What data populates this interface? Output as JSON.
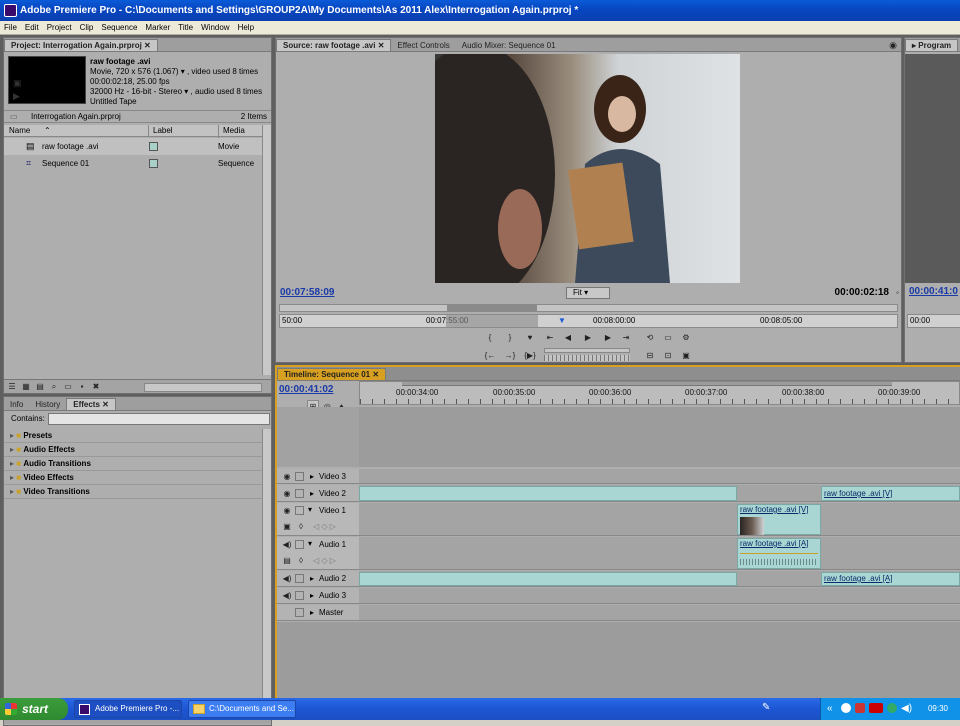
{
  "window": {
    "title": "Adobe Premiere Pro - C:\\Documents and Settings\\GROUP2A\\My Documents\\As 2011 Alex\\Interrogation Again.prproj *"
  },
  "menu": [
    "File",
    "Edit",
    "Project",
    "Clip",
    "Sequence",
    "Marker",
    "Title",
    "Window",
    "Help"
  ],
  "project": {
    "tab": "Project: Interrogation Again.prproj",
    "clip_name": "raw footage .avi",
    "clip_info": [
      "Movie, 720 x 576 (1.067)  ▾  , video used 8 times",
      "00:00:02:18, 25.00 fps",
      "32000 Hz - 16-bit - Stereo  ▾  , audio used 8 times",
      "Untitled Tape"
    ],
    "file": "Interrogation Again.prproj",
    "count": "2 Items",
    "columns": [
      "Name",
      "Label",
      "Media Type"
    ],
    "rows": [
      {
        "name": "raw footage .avi",
        "type": "Movie"
      },
      {
        "name": "Sequence 01",
        "type": "Sequence"
      }
    ]
  },
  "source": {
    "tabs": [
      "Source: raw footage .avi",
      "Effect Controls",
      "Audio Mixer: Sequence 01"
    ],
    "timecode_left": "00:07:58:09",
    "fit": "Fit",
    "timecode_right": "00:00:02:18",
    "ruler": [
      "50:00",
      "00:07:55:00",
      "00:08:00:00",
      "00:08:05:00"
    ]
  },
  "program": {
    "tab": "Program",
    "timecode": "00:00:41:0",
    "ruler": "00:00"
  },
  "effects": {
    "tabs": [
      "Info",
      "History",
      "Effects"
    ],
    "contains": "Contains:",
    "folders": [
      "Presets",
      "Audio Effects",
      "Audio Transitions",
      "Video Effects",
      "Video Transitions"
    ]
  },
  "timeline": {
    "tab": "Timeline: Sequence 01",
    "timecode": "00:00:41:02",
    "ruler": [
      "00:00:34:00",
      "00:00:35:00",
      "00:00:36:00",
      "00:00:37:00",
      "00:00:38:00",
      "00:00:39:00"
    ],
    "tracks": [
      "Video 3",
      "Video 2",
      "Video 1",
      "Audio 1",
      "Audio 2",
      "Audio 3",
      "Master"
    ],
    "clip_labels": {
      "v2": "raw footage .avi [V]",
      "v1": "raw footage .avi [V]",
      "a1": "raw footage .avi [A]",
      "a2": "raw footage .avi [A]"
    }
  },
  "taskbar": {
    "start": "start",
    "items": [
      "Adobe Premiere Pro -...",
      "C:\\Documents and Se..."
    ],
    "time": "09:30"
  }
}
